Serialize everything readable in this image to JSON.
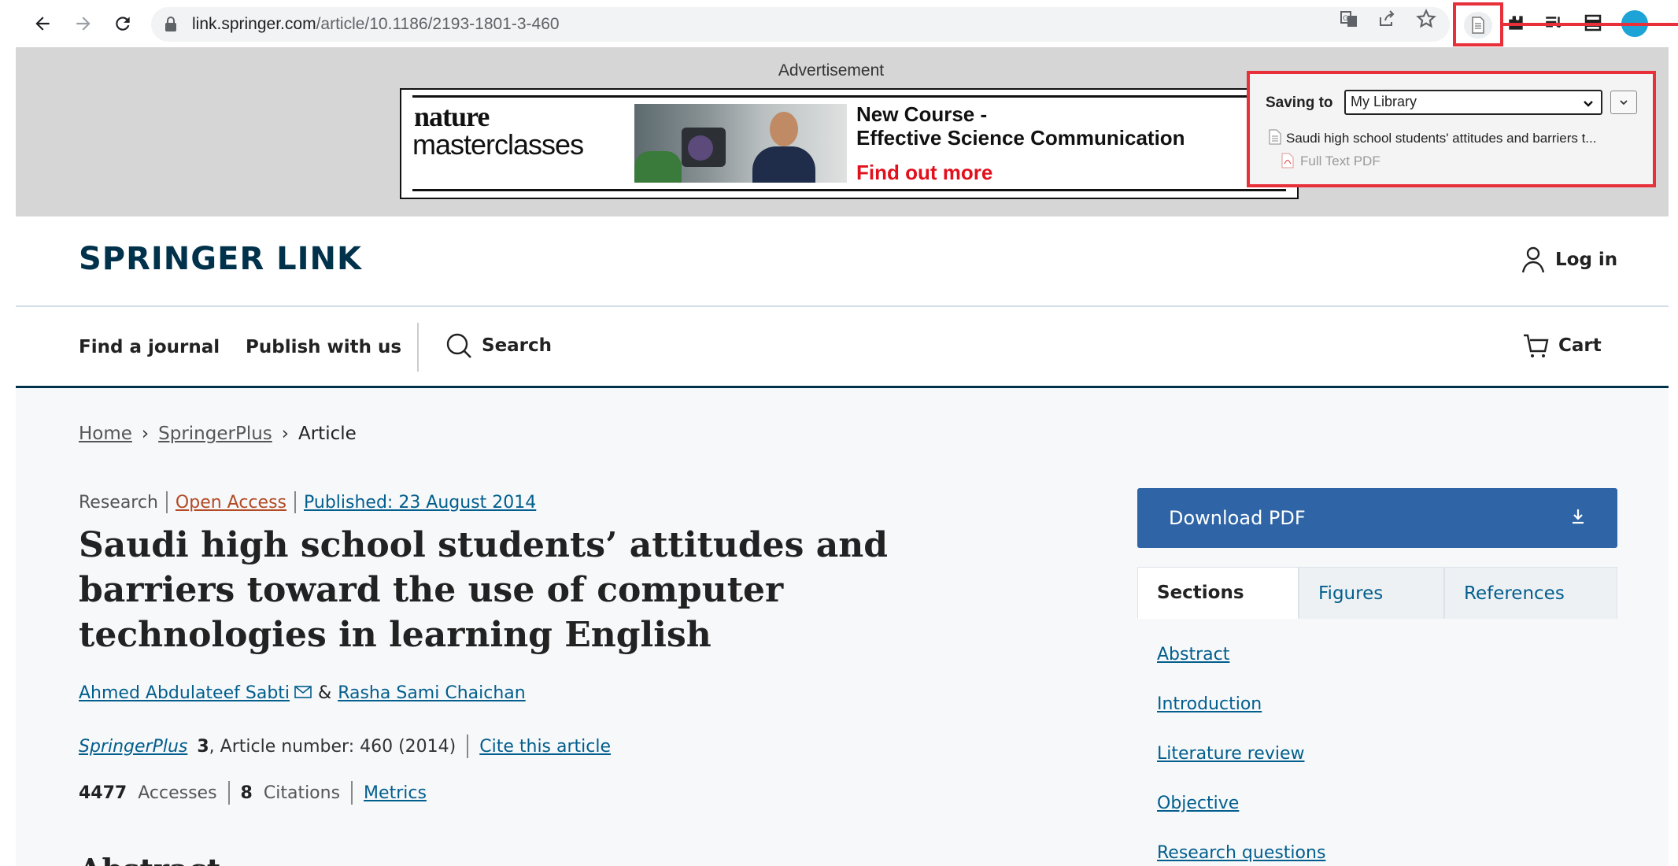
{
  "browser": {
    "url_host": "link.springer.com",
    "url_path": "/article/10.1186/2193-1801-3-460"
  },
  "ad": {
    "label": "Advertisement",
    "brand_line1": "nature",
    "brand_line2": "masterclasses",
    "headline1": "New Course -",
    "headline2": "Effective Science Communication",
    "cta": "Find out more"
  },
  "zotero": {
    "saving_to_label": "Saving to",
    "library": "My Library",
    "item_title": "Saudi high school students' attitudes and barriers t...",
    "attachment": "Full Text PDF"
  },
  "header": {
    "brand": "SPRINGER LINK",
    "login": "Log in",
    "nav": {
      "find_journal": "Find a journal",
      "publish": "Publish with us",
      "search": "Search",
      "cart": "Cart"
    }
  },
  "breadcrumb": {
    "home": "Home",
    "journal": "SpringerPlus",
    "current": "Article"
  },
  "article": {
    "type": "Research",
    "access": "Open Access",
    "published": "Published: 23 August 2014",
    "title": "Saudi high school students’ attitudes and barriers toward the use of computer technologies in learning English",
    "author1": "Ahmed Abdulateef Sabti",
    "author_sep": "&",
    "author2": "Rasha Sami Chaichan",
    "journal": "SpringerPlus",
    "volume": "3",
    "article_number": ", Article number: 460 (2014)",
    "cite": "Cite this article",
    "accesses_count": "4477",
    "accesses_label": "Accesses",
    "citations_count": "8",
    "citations_label": "Citations",
    "metrics": "Metrics",
    "abstract_heading": "Abstract"
  },
  "sidebar": {
    "download": "Download PDF",
    "tabs": [
      "Sections",
      "Figures",
      "References"
    ],
    "sections": [
      "Abstract",
      "Introduction",
      "Literature review",
      "Objective",
      "Research questions"
    ]
  }
}
